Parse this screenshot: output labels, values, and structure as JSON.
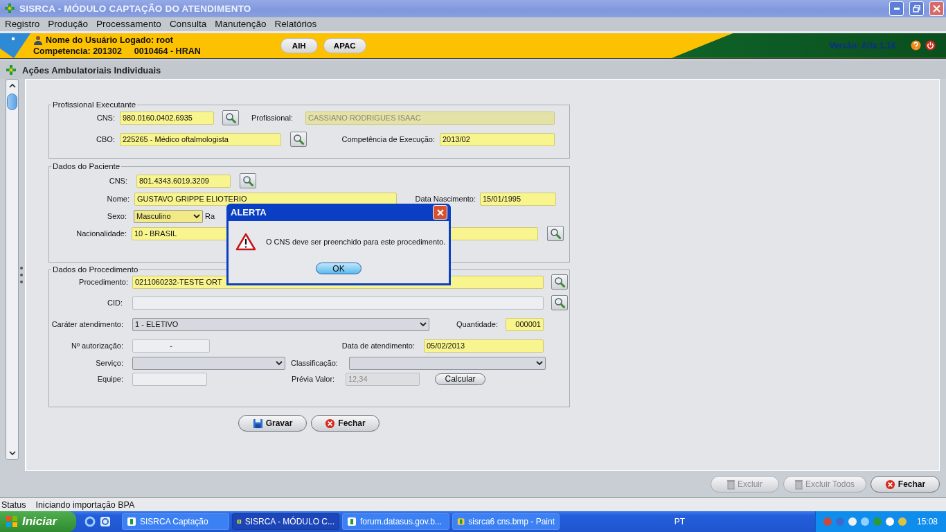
{
  "window": {
    "title": "SISRCA - MÓDULO CAPTAÇÃO DO ATENDIMENTO"
  },
  "menu": [
    "Registro",
    "Produção",
    "Processamento",
    "Consulta",
    "Manutenção",
    "Relatórios"
  ],
  "banner": {
    "user": "Nome do Usuário Logado: root",
    "competence": "Competencia: 201302",
    "unit": "0010464 - HRAN",
    "buttons": [
      "AIH",
      "APAC"
    ],
    "version": "Versão: Alfa 1.14"
  },
  "screen_title": "Ações Ambulatoriais Individuais",
  "professional": {
    "legend": "Profissional Executante",
    "cns": {
      "label": "CNS:",
      "value": "980.0160.0402.6935",
      "required": true,
      "disabled": false
    },
    "name": {
      "label": "Profissional:",
      "value": "CASSIANO RODRIGUES ISAAC",
      "required": true,
      "disabled": true
    },
    "cbo": {
      "label": "CBO:",
      "value": "225265 - Médico oftalmologista",
      "required": true,
      "disabled": false
    },
    "competence": {
      "label": "Competência de Execução:",
      "value": "2013/02",
      "required": true,
      "disabled": false
    }
  },
  "patient": {
    "legend": "Dados do Paciente",
    "cns": {
      "label": "CNS:",
      "value": "801.4343.6019.3209",
      "required": true,
      "disabled": false
    },
    "name": {
      "label": "Nome:",
      "value": "GUSTAVO GRIPPE ELIOTERIO",
      "required": true,
      "disabled": false
    },
    "birth": {
      "label": "Data Nascimento:",
      "value": "15/01/1995",
      "required": true,
      "disabled": false
    },
    "sex": {
      "label": "Sexo:",
      "value": "Masculino",
      "required": true
    },
    "race_label": "Ra",
    "nationality": {
      "label": "Nacionalidade:",
      "value": "10 - BRASIL",
      "required": true,
      "disabled": false
    }
  },
  "procedure": {
    "legend": "Dados do Procedimento",
    "procedure": {
      "label": "Procedimento:",
      "value": "0211060232-TESTE ORT",
      "required": true,
      "disabled": false
    },
    "cid": {
      "label": "CID:",
      "required": false,
      "disabled": false
    },
    "character": {
      "label": "Caráter atendimento:",
      "value": "1 - ELETIVO",
      "required": false
    },
    "quantity": {
      "label": "Quantidade:",
      "value": "000001",
      "required": true,
      "disabled": false
    },
    "authorization": {
      "label": "Nº autorização:",
      "value": "-",
      "required": false,
      "disabled": false
    },
    "date": {
      "label": "Data de atendimento:",
      "value": "05/02/2013",
      "required": true,
      "disabled": false
    },
    "service": {
      "label": "Serviço:",
      "required": false
    },
    "classification": {
      "label": "Classificação:",
      "required": false
    },
    "team": {
      "label": "Equipe:",
      "required": false,
      "disabled": false
    },
    "value": {
      "label": "Prévia Valor:",
      "value": "12,34",
      "required": false,
      "disabled": true
    },
    "calculate": "Calcular"
  },
  "actions": [
    "Gravar",
    "Fechar"
  ],
  "dialog": {
    "title": "ALERTA",
    "message": "O CNS deve ser preenchido para este procedimento.",
    "button": "OK"
  },
  "footer_buttons": [
    {
      "label": "Excluir",
      "kind": "delete",
      "disabled": true
    },
    {
      "label": "Excluir Todos",
      "kind": "delete",
      "disabled": true
    },
    {
      "label": "Fechar",
      "kind": "close",
      "disabled": false
    }
  ],
  "status": {
    "label": "Status",
    "text": "Iniciando importação BPA"
  },
  "taskbar": {
    "start": "Iniciar",
    "tasks": [
      {
        "label": "SISRCA Captação",
        "selected": false
      },
      {
        "label": "SISRCA - MÓDULO C...",
        "selected": true
      },
      {
        "label": "forum.datasus.gov.b...",
        "selected": false
      },
      {
        "label": "sisrca6 cns.bmp - Paint",
        "selected": false
      }
    ],
    "language": "PT",
    "clock": "15:08"
  }
}
